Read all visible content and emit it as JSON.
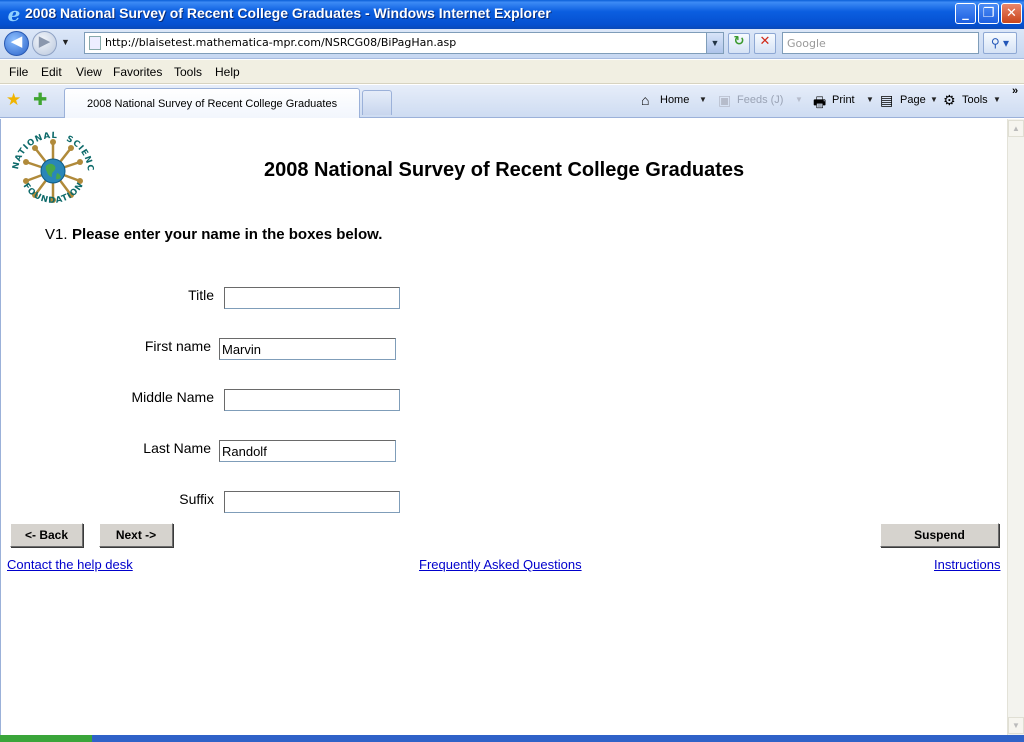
{
  "window": {
    "title": "2008 National Survey of Recent College Graduates - Windows Internet Explorer",
    "minimize": "_",
    "restore": "❐",
    "close": "✕"
  },
  "address_bar": {
    "url": "http://blaisetest.mathematica-mpr.com/NSRCG08/BiPagHan.asp",
    "search_placeholder": "Google"
  },
  "menu": [
    "File",
    "Edit",
    "View",
    "Favorites",
    "Tools",
    "Help"
  ],
  "tabs": {
    "active_label": "2008 National Survey of Recent College Graduates"
  },
  "commands": {
    "home": "Home",
    "feeds": "Feeds (J)",
    "print": "Print",
    "page": "Page",
    "tools": "Tools"
  },
  "page": {
    "logo_text": [
      "NATIONAL",
      "SCIENCE",
      "FOUNDATION"
    ],
    "survey_title": "2008 National Survey of Recent College Graduates",
    "question_number": "V1.",
    "question_text": "Please enter your name in the boxes below.",
    "fields": {
      "title": {
        "label": "Title",
        "value": ""
      },
      "first_name": {
        "label": "First name",
        "value": "Marvin"
      },
      "middle_name": {
        "label": "Middle Name",
        "value": ""
      },
      "last_name": {
        "label": "Last Name",
        "value": "Randolf"
      },
      "suffix": {
        "label": "Suffix",
        "value": ""
      }
    },
    "buttons": {
      "back": "<- Back",
      "next": "Next ->",
      "suspend": "Suspend"
    },
    "links": {
      "help_desk": "Contact the help desk",
      "faq": "Frequently Asked Questions",
      "instructions": "Instructions"
    }
  }
}
